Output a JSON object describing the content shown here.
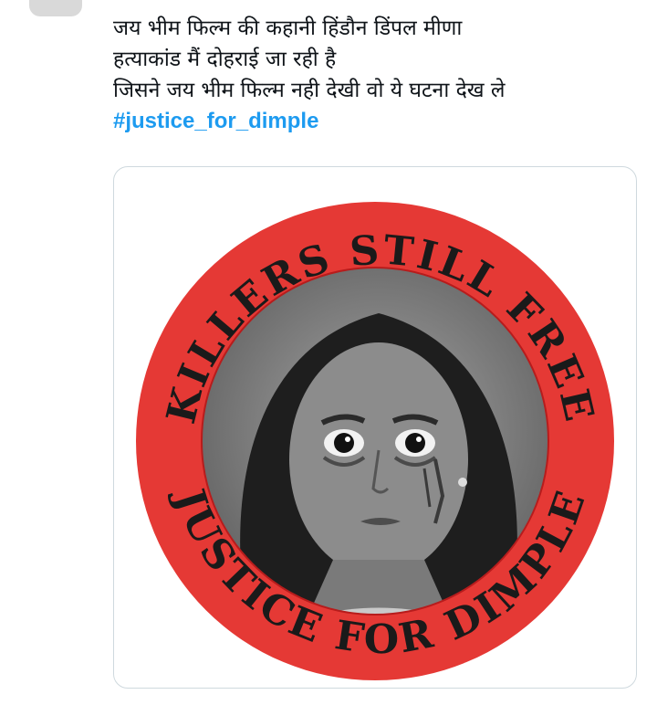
{
  "tweet": {
    "text_lines": [
      "जय भीम फिल्म की कहानी हिंडौन डिंपल मीणा",
      "हत्याकांड मैं दोहराई जा रही है",
      "जिसने जय भीम फिल्म नही देखी वो ये घटना देख ले"
    ],
    "hashtag": "#justice_for_dimple"
  },
  "media": {
    "top_arc_text": "KILLERS STILL FREE",
    "bottom_arc_text": "JUSTICE FOR DIMPLE",
    "ring_color": "#e53935",
    "text_color": "#1a1a1a",
    "portrait_description_icon": "girl-portrait-illustration"
  }
}
